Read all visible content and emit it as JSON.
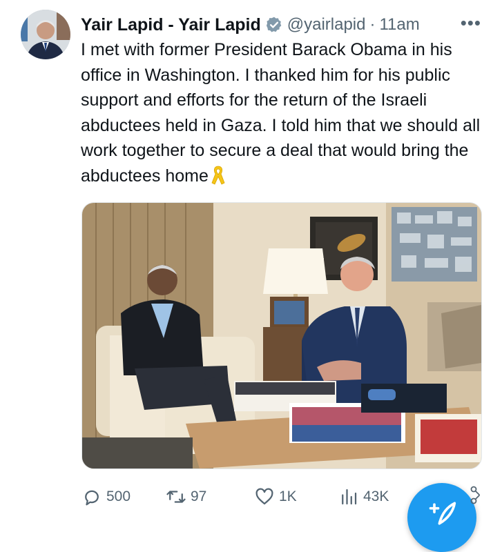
{
  "tweet": {
    "author_name": "Yair Lapid - Yair Lapid",
    "handle": "@yairlapid",
    "separator": "·",
    "time": "11am",
    "more_label": "•••",
    "text": "I met with former President Barack Obama in his office in Washington. I thanked him for his public support and efforts for the return of the Israeli abductees held in Gaza. I told him that we should all work together to secure a deal that would bring the abductees home",
    "emoji": "yellow-ribbon",
    "verified_color": "#829aab"
  },
  "actions": {
    "replies": "500",
    "retweets": "97",
    "likes": "1K",
    "views": "43K"
  },
  "colors": {
    "accent": "#1d9bf0",
    "secondary_text": "#536471",
    "ribbon": "#f5c518"
  }
}
